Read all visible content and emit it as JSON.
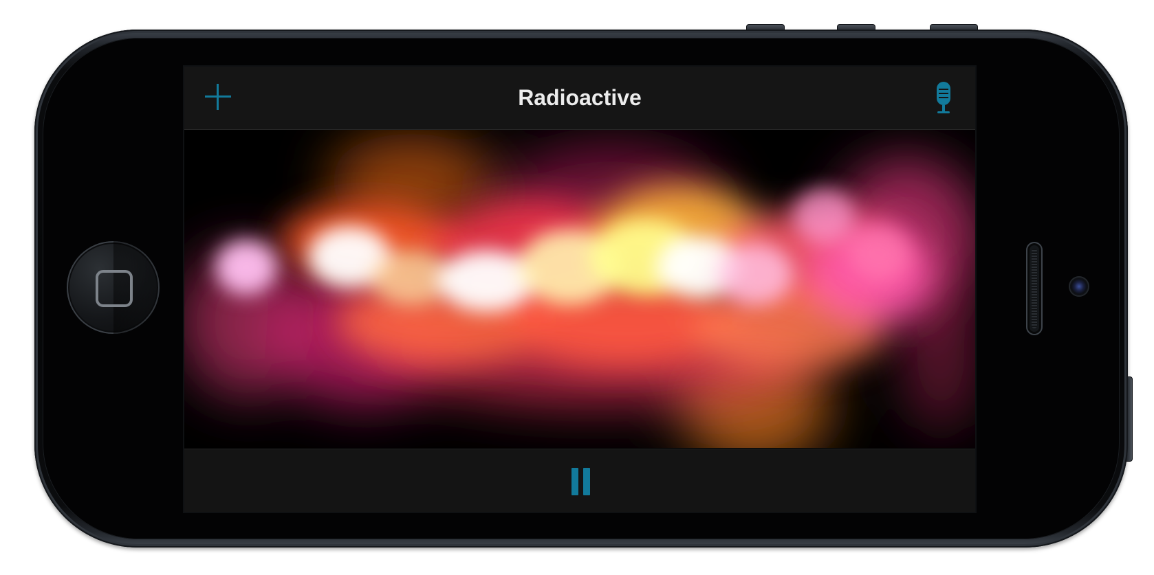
{
  "app": {
    "title": "Radioactive"
  },
  "nav": {
    "left_icon": "plus-icon",
    "right_icon": "microphone-icon"
  },
  "toolbar": {
    "center_icon": "pause-icon"
  },
  "colors": {
    "accent": "#127a9b",
    "nav_background": "#151515",
    "title_text": "#ececec"
  }
}
